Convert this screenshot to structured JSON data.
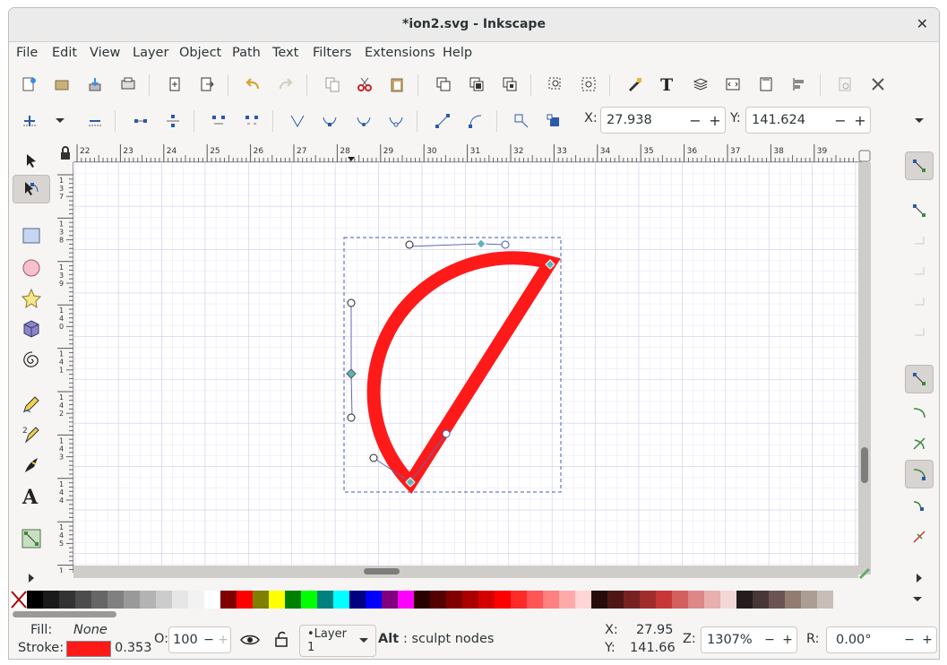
{
  "window": {
    "title": "*ion2.svg - Inkscape",
    "close_glyph": "✕"
  },
  "menu": [
    {
      "label": "File"
    },
    {
      "label": "Edit"
    },
    {
      "label": "View"
    },
    {
      "label": "Layer"
    },
    {
      "label": "Object"
    },
    {
      "label": "Path"
    },
    {
      "label": "Text"
    },
    {
      "label": "Filters"
    },
    {
      "label": "Extensions"
    },
    {
      "label": "Help"
    }
  ],
  "toolbar1_icons": [
    "new-document-icon",
    "open-file-icon",
    "import-icon",
    "print-icon",
    "save-as-icon",
    "export-icon",
    "undo-icon",
    "redo-icon",
    "copy-icon",
    "cut-icon",
    "paste-icon",
    "duplicate-icon",
    "clone-icon",
    "unlink-clone-icon",
    "zoom-selection-icon",
    "zoom-drawing-icon",
    "fill-stroke-icon",
    "text-font-icon",
    "layers-icon",
    "xml-editor-icon",
    "document-properties-icon",
    "align-distribute-icon",
    "preferences-icon",
    "tool-settings-icon"
  ],
  "node_toolbar": {
    "x_label": "X:",
    "x_value": "27.938",
    "y_label": "Y:",
    "y_value": "141.624",
    "minus": "−",
    "plus": "+"
  },
  "ruler_top_labels": [
    "22",
    "23",
    "24",
    "25",
    "26",
    "27",
    "28",
    "29",
    "30",
    "31",
    "32",
    "33",
    "34",
    "35",
    "36",
    "37",
    "38",
    "39"
  ],
  "ruler_left_labels": [
    "1\n3\n7",
    "1\n3\n8",
    "1\n3\n9",
    "1\n4\n0",
    "1\n4\n1",
    "1\n4\n2",
    "1\n4\n3",
    "1\n4\n4",
    "1\n4\n5",
    "1\n4\n6"
  ],
  "tools": [
    "selector-tool-icon",
    "node-tool-icon",
    "rectangle-tool-icon",
    "ellipse-tool-icon",
    "star-tool-icon",
    "3d-box-tool-icon",
    "spiral-tool-icon",
    "pencil-tool-icon",
    "pen-tool-icon",
    "calligraphy-tool-icon",
    "text-tool-icon",
    "connector-tool-icon"
  ],
  "palette_colors": [
    "#000000",
    "#1a1a1a",
    "#333333",
    "#4d4d4d",
    "#666666",
    "#808080",
    "#999999",
    "#b3b3b3",
    "#cccccc",
    "#e6e6e6",
    "#f2f2f2",
    "#ffffff",
    "#800000",
    "#ff0000",
    "#808000",
    "#ffff00",
    "#008000",
    "#00ff00",
    "#008080",
    "#00ffff",
    "#000080",
    "#0000ff",
    "#800080",
    "#ff00ff",
    "#2b0000",
    "#550000",
    "#800000",
    "#aa0000",
    "#d40000",
    "#ff0000",
    "#ff2a2a",
    "#ff5555",
    "#ff8080",
    "#ffaaaa",
    "#ffd5d5",
    "#280b0b",
    "#501616",
    "#782121",
    "#a02c2c",
    "#c83737",
    "#d35f5f",
    "#de8787",
    "#e9afaf",
    "#f4d7d7",
    "#241c1c",
    "#483737",
    "#6c5353",
    "#917c6f",
    "#ac9d93",
    "#c8beb7"
  ],
  "status": {
    "fill_label": "Fill:",
    "fill_value": "None",
    "stroke_label": "Stroke:",
    "stroke_color": "#ff1a1a",
    "stroke_width": "0.353",
    "opacity_label": "O:",
    "opacity_value": "100",
    "layer": "•Layer 1",
    "hint_key": "Alt",
    "hint_text": ": sculpt nodes",
    "x_label": "X:",
    "x_value": "27.95",
    "y_label": "Y:",
    "y_value": "141.66",
    "zoom_label": "Z:",
    "zoom_value": "1307%",
    "rotation_label": "R:",
    "rotation_value": "0.00°"
  },
  "colors": {
    "accent_path": "#ff1a1a",
    "grid": "#d6d6f2",
    "node": "#5fb3b3"
  }
}
